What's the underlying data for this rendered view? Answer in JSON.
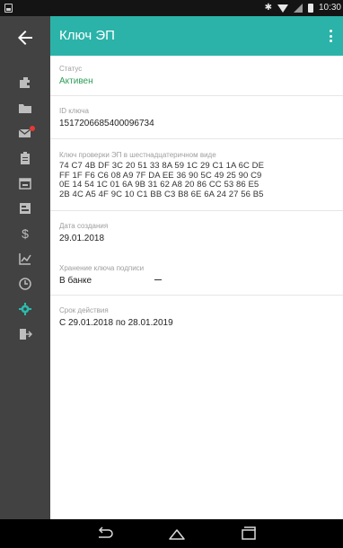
{
  "status_bar": {
    "time": "10:30"
  },
  "toolbar": {
    "title": "Ключ ЭП",
    "back_icon": "arrow-back-icon",
    "menu_icon": "more-vert-icon"
  },
  "fields": {
    "status": {
      "label": "Статус",
      "value": "Активен",
      "color": "#2e9d57"
    },
    "key_id": {
      "label": "ID ключа",
      "value": "1517206685400096734"
    },
    "verification_key": {
      "label": "Ключ проверки ЭП в шестнадцатеричном виде",
      "lines": [
        "74 C7 4B DF 3C 20 51 33 8A 59 1C 29 C1 1A 6C DE",
        "FF 1F F6 C6 08 A9 7F DA EE 36 90 5C 49 25 90 C9",
        "0E 14 54 1C 01 6A 9B 31 62 A8 20 86 CC 53 86 E5",
        "2B 4C A5 4F 9C 10 C1 BB C3 B8 6E 6A 24 27 56 B5"
      ]
    },
    "created": {
      "label": "Дата создания",
      "value": "29.01.2018"
    },
    "storage": {
      "label": "Хранение ключа подписи",
      "value": "В банке"
    },
    "validity": {
      "label": "Срок действия",
      "value": "С 29.01.2018 по 28.01.2019"
    }
  },
  "colors": {
    "accent": "#2bb3a9",
    "rail": "#424242"
  }
}
